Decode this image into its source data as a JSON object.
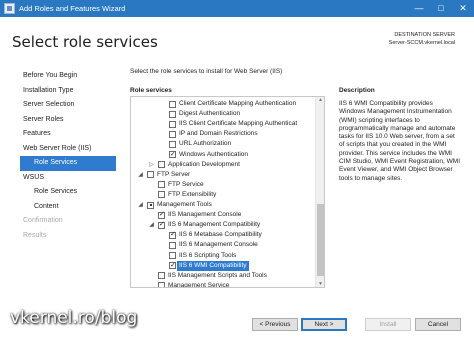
{
  "window": {
    "title": "Add Roles and Features Wizard"
  },
  "header": {
    "title": "Select role services",
    "destination_label": "DESTINATION SERVER",
    "destination_value": "Server-SCCM.vkernel.local"
  },
  "nav": {
    "items": [
      {
        "label": "Before You Begin",
        "state": "normal"
      },
      {
        "label": "Installation Type",
        "state": "normal"
      },
      {
        "label": "Server Selection",
        "state": "normal"
      },
      {
        "label": "Server Roles",
        "state": "normal"
      },
      {
        "label": "Features",
        "state": "normal"
      },
      {
        "label": "Web Server Role (IIS)",
        "state": "normal"
      },
      {
        "label": "Role Services",
        "state": "active"
      },
      {
        "label": "WSUS",
        "state": "normal"
      },
      {
        "label": "Role Services",
        "state": "normal"
      },
      {
        "label": "Content",
        "state": "normal"
      },
      {
        "label": "Confirmation",
        "state": "disabled"
      },
      {
        "label": "Results",
        "state": "disabled"
      }
    ]
  },
  "main": {
    "instruction": "Select the role services to install for Web Server (IIS)",
    "role_services_label": "Role services",
    "description_label": "Description",
    "description_text": "IIS 6 WMI Compatibility provides Windows Management Instrumentation (WMI) scripting interfaces to programmatically manage and automate tasks for IIS 10.0 Web server, from a set of scripts that you created in the WMI provider. This service includes the WMI CIM Studio, WMI Event Registration, WMI Event Viewer, and WMI Object Browser tools to manage sites."
  },
  "tree": {
    "items": [
      {
        "label": "Client Certificate Mapping Authentication",
        "checked": false
      },
      {
        "label": "Digest Authentication",
        "checked": false
      },
      {
        "label": "IIS Client Certificate Mapping Authenticat",
        "checked": false
      },
      {
        "label": "IP and Domain Restrictions",
        "checked": false
      },
      {
        "label": "URL Authorization",
        "checked": false
      },
      {
        "label": "Windows Authentication",
        "checked": true
      },
      {
        "label": "Application Development",
        "checked": false,
        "expander": "▷"
      },
      {
        "label": "FTP Server",
        "checked": false,
        "expander": "◢"
      },
      {
        "label": "FTP Service",
        "checked": false
      },
      {
        "label": "FTP Extensibility",
        "checked": false
      },
      {
        "label": "Management Tools",
        "checked": "partial",
        "expander": "◢"
      },
      {
        "label": "IIS Management Console",
        "checked": true
      },
      {
        "label": "IIS 6 Management Compatibility",
        "checked": true,
        "expander": "◢"
      },
      {
        "label": "IIS 6 Metabase Compatibility",
        "checked": true
      },
      {
        "label": "IIS 6 Management Console",
        "checked": false
      },
      {
        "label": "IIS 6 Scripting Tools",
        "checked": false
      },
      {
        "label": "IIS 6 WMI Compatibility",
        "checked": true,
        "selected": true
      },
      {
        "label": "IIS Management Scripts and Tools",
        "checked": false
      },
      {
        "label": "Management Service",
        "checked": false
      }
    ]
  },
  "footer": {
    "watermark": "vkernel.ro/blog",
    "previous_label": "< Previous",
    "next_label": "Next >",
    "install_label": "Install",
    "cancel_label": "Cancel"
  },
  "titlebar": {
    "minimize": "—",
    "maximize": "□",
    "close": "✕"
  }
}
